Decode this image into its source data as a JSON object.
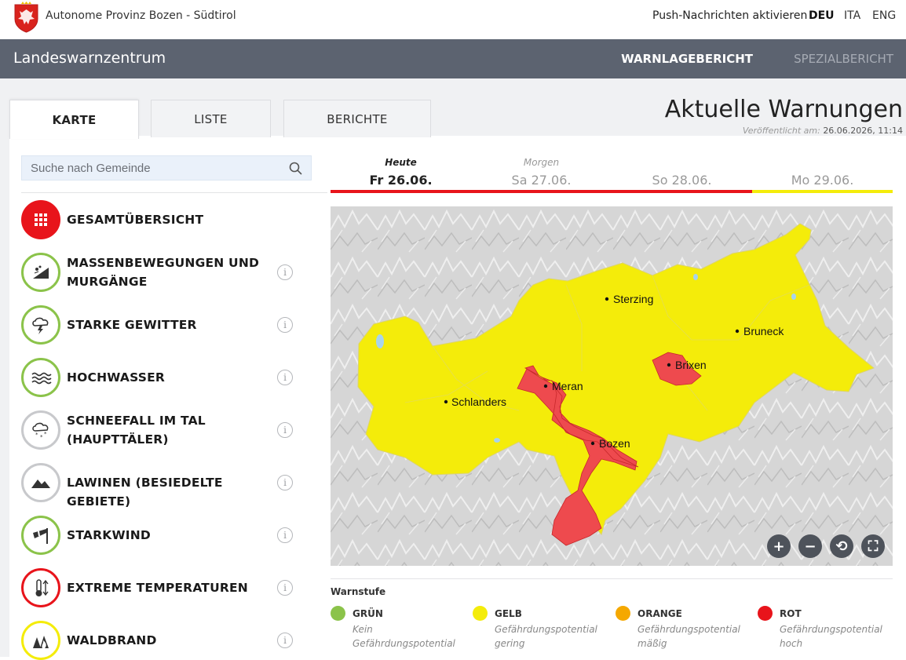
{
  "topbar": {
    "org_name": "Autonome Provinz Bozen - Südtirol",
    "push": "Push-Nachrichten aktivieren",
    "languages": [
      "DEU",
      "ITA",
      "ENG"
    ],
    "active_language": "DEU"
  },
  "navbar": {
    "brand": "Landeswarnzentrum",
    "items": [
      "WARNLAGEBERICHT",
      "SPEZIALBERICHT"
    ]
  },
  "tabs": [
    "KARTE",
    "LISTE",
    "BERICHTE"
  ],
  "header": {
    "title": "Aktuelle Warnungen",
    "published_label": "Veröffentlicht am:",
    "published_value": "26.06.2026, 11:14"
  },
  "search": {
    "placeholder": "Suche nach Gemeinde",
    "icon": "search-icon"
  },
  "categories": [
    {
      "label": "GESAMTÜBERSICHT",
      "icon": "grid-icon",
      "status": "red-filled"
    },
    {
      "label": "MASSENBEWEGUNGEN UND MURGÄNGE",
      "icon": "landslide-icon",
      "status": "green"
    },
    {
      "label": "STARKE GEWITTER",
      "icon": "thunderstorm-icon",
      "status": "green"
    },
    {
      "label": "HOCHWASSER",
      "icon": "water-waves-icon",
      "status": "green"
    },
    {
      "label": "SCHNEEFALL IM TAL (HAUPTTÄLER)",
      "icon": "snowfall-icon",
      "status": "grey"
    },
    {
      "label": "LAWINEN (BESIEDELTE GEBIETE)",
      "icon": "mountain-icon",
      "status": "grey"
    },
    {
      "label": "STARKWIND",
      "icon": "windsock-icon",
      "status": "green"
    },
    {
      "label": "EXTREME TEMPERATUREN",
      "icon": "thermometer-icon",
      "status": "red"
    },
    {
      "label": "WALDBRAND",
      "icon": "forest-fire-icon",
      "status": "yellow"
    }
  ],
  "info_glyph": "i",
  "days": [
    {
      "label": "Heute",
      "date": "Fr 26.06.",
      "level": "red"
    },
    {
      "label": "Morgen",
      "date": "Sa 27.06.",
      "level": "red"
    },
    {
      "label": "",
      "date": "So 28.06.",
      "level": "red"
    },
    {
      "label": "",
      "date": "Mo 29.06.",
      "level": "yellow"
    }
  ],
  "map": {
    "towns": [
      "Sterzing",
      "Bruneck",
      "Brixen",
      "Meran",
      "Schlanders",
      "Bozen"
    ],
    "controls": [
      "+",
      "−",
      "⟲",
      "⛶"
    ]
  },
  "legend": {
    "title": "Warnstufe",
    "items": [
      {
        "name": "GRÜN",
        "desc": "Kein Gefährdungspotential",
        "color": "#8bc34a"
      },
      {
        "name": "GELB",
        "desc": "Gefährdungspotential gering",
        "color": "#f4ec0a"
      },
      {
        "name": "ORANGE",
        "desc": "Gefährdungspotential mäßig",
        "color": "#f5a800"
      },
      {
        "name": "ROT",
        "desc": "Gefährdungspotential hoch",
        "color": "#e8141b"
      }
    ]
  },
  "colors": {
    "red": "#e8141b",
    "yellow": "#f4ec0a",
    "green": "#8bc34a",
    "nav": "#5c6370"
  }
}
